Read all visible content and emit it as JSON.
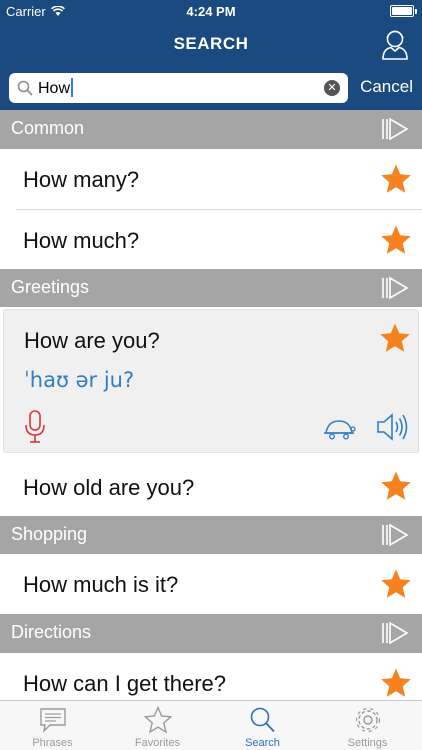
{
  "status": {
    "carrier": "Carrier",
    "time": "4:24 PM"
  },
  "nav": {
    "title": "SEARCH"
  },
  "search": {
    "query": "How",
    "cancel": "Cancel"
  },
  "sections": [
    {
      "label": "Common"
    },
    {
      "label": "Greetings"
    },
    {
      "label": "Shopping"
    },
    {
      "label": "Directions"
    }
  ],
  "phrases": {
    "how_many": "How many?",
    "how_much": "How much?",
    "how_are_you": "How are you?",
    "how_are_you_ipa": "ˈhaʊ ər ju?",
    "how_old": "How old are you?",
    "how_much_is_it": "How much is it?",
    "how_get_there": "How can I get there?"
  },
  "tabs": [
    {
      "label": "Phrases"
    },
    {
      "label": "Favorites"
    },
    {
      "label": "Search"
    },
    {
      "label": "Settings"
    }
  ],
  "colors": {
    "accent": "#1a4a7f",
    "star": "#f5821f",
    "section": "#a5a5a5",
    "active_tab": "#2f6fbf",
    "mic": "#d9373a"
  },
  "active_tab": "Search"
}
